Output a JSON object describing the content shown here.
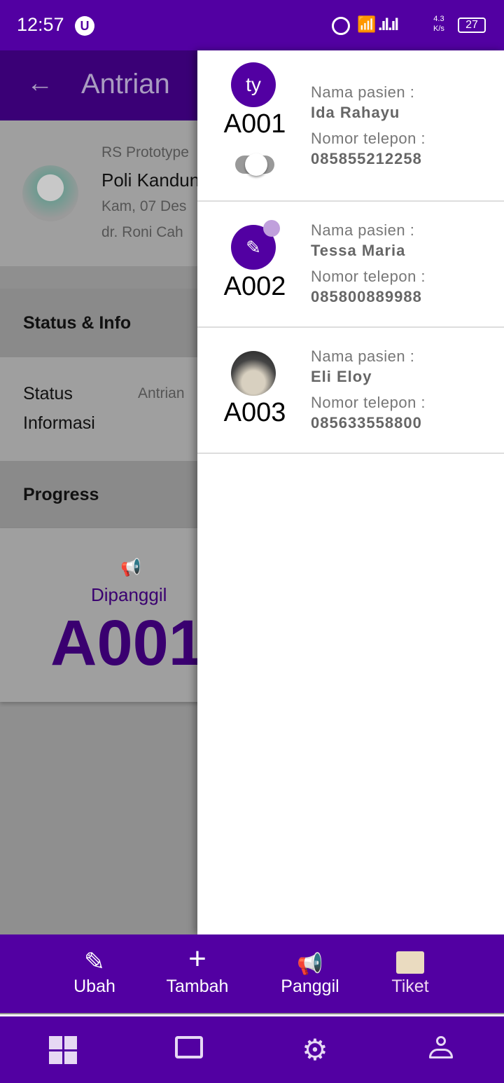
{
  "status_bar": {
    "time": "12:57",
    "net_speed_value": "4.3",
    "net_speed_unit": "K/s",
    "battery": "27"
  },
  "app_bar": {
    "title": "Antrian"
  },
  "doctor_card": {
    "hospital": "RS Prototype",
    "poli": "Poli Kandungan",
    "date": "Kam, 07 Des",
    "doctor": "dr. Roni Cah"
  },
  "status_info": {
    "header": "Status & Info",
    "label_status": "Status",
    "label_info": "Informasi",
    "status_value": "Antrian"
  },
  "progress": {
    "header": "Progress",
    "called_label": "Dipanggil",
    "called_code": "A001"
  },
  "drawer": {
    "items": [
      {
        "avatar": "ty",
        "code": "A001",
        "name_label": "Nama pasien :",
        "name": "Ida Rahayu",
        "phone_label": "Nomor telepon :",
        "phone": "085855212258",
        "toggle_on": false
      },
      {
        "avatar_icon": "test-tube-icon",
        "code": "A002",
        "name_label": "Nama pasien :",
        "name": "Tessa Maria",
        "phone_label": "Nomor telepon :",
        "phone": "085800889988"
      },
      {
        "avatar_icon": "photo",
        "code": "A003",
        "name_label": "Nama pasien :",
        "name": "Eli Eloy",
        "phone_label": "Nomor telepon :",
        "phone": "085633558800"
      }
    ]
  },
  "actions": [
    {
      "label": "Ubah",
      "icon": "pencil-icon"
    },
    {
      "label": "Tambah",
      "icon": "plus-icon"
    },
    {
      "label": "Panggil",
      "icon": "megaphone-icon"
    },
    {
      "label": "Tiket",
      "icon": "ticket-icon",
      "active": true
    }
  ],
  "nav": [
    "dashboard-icon",
    "monitor-icon",
    "gear-icon",
    "person-icon"
  ],
  "colors": {
    "primary": "#5200a2",
    "active_tab": "#f0d8f0",
    "ticket": "#eadbc0"
  }
}
